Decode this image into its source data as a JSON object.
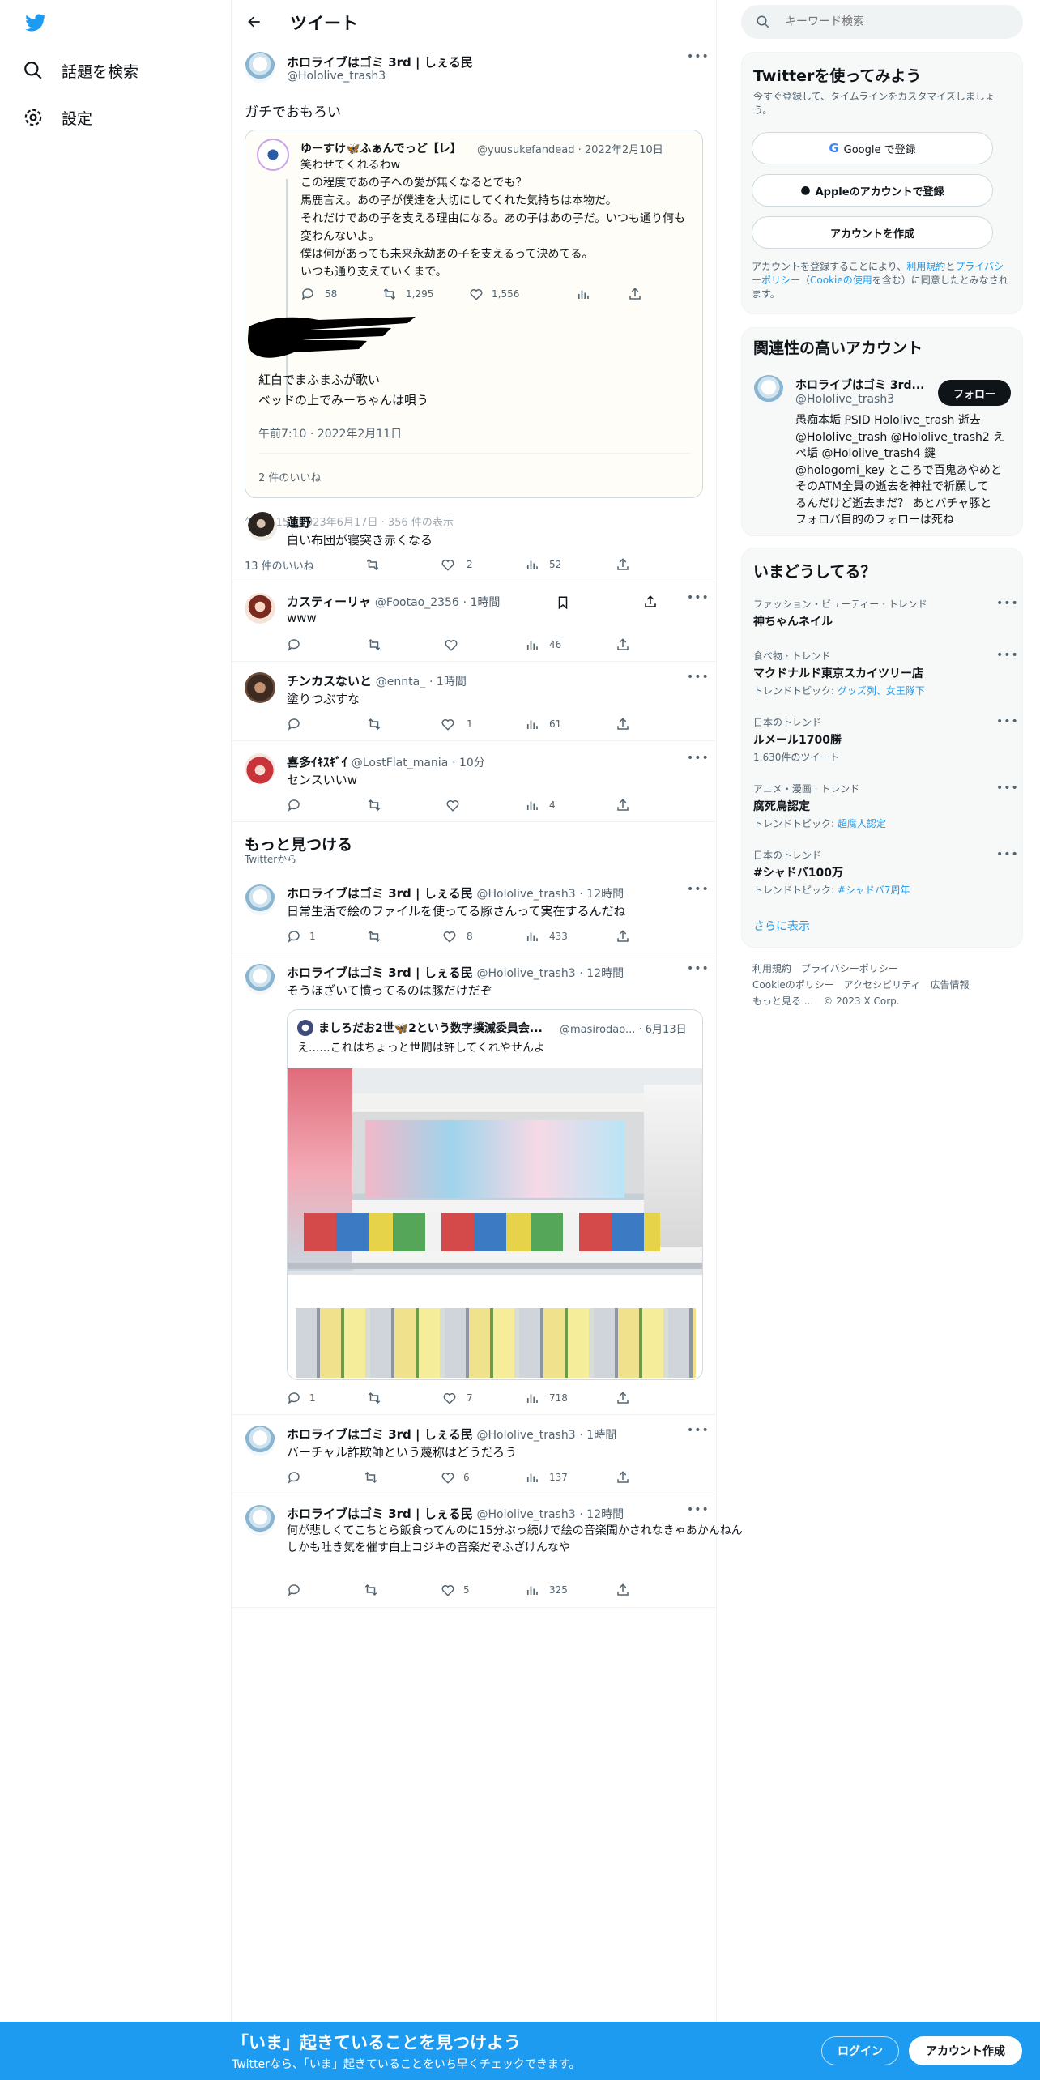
{
  "nav": {
    "search": "話題を検索",
    "settings": "設定"
  },
  "header": {
    "title": "ツイート"
  },
  "main_tweet": {
    "name": "ホロライブはゴミ 3rd | しぇる民",
    "handle": "@Hololive_trash3",
    "text": "ガチでおもろい",
    "quote": {
      "name": "ゆーすけ🦋ふぁんでっど【レ】",
      "handle": "@yuusukefandead",
      "date": "· 2022年2月10日",
      "lines": [
        "笑わせてくれるわw",
        "この程度であの子への愛が無くなるとでも？",
        "馬鹿言え。あの子が僕達を大切にしてくれた気持ちは本物だ。",
        "それだけであの子を支える理由になる。あの子はあの子だ。いつも通り何も",
        "変わんないよ。",
        "僕は何があっても未来永劫あの子を支えるって決めてる。",
        "いつも通り支えていくまで。"
      ],
      "replies": "58",
      "retweets": "1,295",
      "likes": "1,556",
      "reply_lines": [
        "紅白でまふまふが歌い",
        "ベッドの上でみーちゃんは唄う"
      ],
      "reply_time": "午前7:10 · 2022年2月11日",
      "reply_likes": "2 件のいいね"
    },
    "overlap_meta": "午前7:15 · 2023年6月17日 · 356 件の表示",
    "likes_count_label": "13 件のいいね"
  },
  "replies": [
    {
      "name": "蓮野",
      "handle": "",
      "time": "",
      "text": "白い布団が寝突き赤くなる",
      "reply": "",
      "retweet": "",
      "like": "2",
      "views": "52"
    },
    {
      "name": "カスティーリャ",
      "handle": "@Footao_2356",
      "time": "· 1時間",
      "text": "www",
      "reply": "",
      "retweet": "",
      "like": "",
      "views": "46"
    },
    {
      "name": "チンカスないと",
      "handle": "@ennta_",
      "time": "· 1時間",
      "text": "塗りつぶすな",
      "reply": "",
      "retweet": "",
      "like": "1",
      "views": "61"
    },
    {
      "name": "喜多ｲｷｽｷﾞｲ",
      "handle": "@LostFlat_mania",
      "time": "· 10分",
      "text": "センスいいw",
      "reply": "",
      "retweet": "",
      "like": "",
      "views": "4"
    }
  ],
  "more": {
    "title": "もっと見つける",
    "subtitle": "Twitterから"
  },
  "more_tweets": [
    {
      "name": "ホロライブはゴミ 3rd | しぇる民",
      "handle": "@Hololive_trash3",
      "time": "· 12時間",
      "lines": [
        "日常生活で絵のファイルを使ってる豚さんって実在するんだね"
      ],
      "reply": "1",
      "like": "8",
      "views": "433"
    },
    {
      "name": "ホロライブはゴミ 3rd | しぇる民",
      "handle": "@Hololive_trash3",
      "time": "· 12時間",
      "lines": [
        "そうほざいて憤ってるのは豚だけだぞ"
      ],
      "reply": "1",
      "like": "7",
      "views": "718",
      "quote": {
        "name": "ましろだお2世🦋2という数字撲滅委員会...",
        "handle": "@masirodao...",
        "date": "· 6月13日",
        "text": "え......これはちょっと世間は許してくれやせんよ"
      }
    },
    {
      "name": "ホロライブはゴミ 3rd | しぇる民",
      "handle": "@Hololive_trash3",
      "time": "· 1時間",
      "lines": [
        "バーチャル詐欺師という蔑称はどうだろう"
      ],
      "reply": "",
      "like": "6",
      "views": "137"
    },
    {
      "name": "ホロライブはゴミ 3rd | しぇる民",
      "handle": "@Hololive_trash3",
      "time": "· 12時間",
      "lines": [
        "何が悲しくてこちとら飯食ってんのに15分ぶっ続けで絵の音楽聞かされなきゃあかんねん",
        "しかも吐き気を催す白上コジキの音楽だぞふざけんなや"
      ],
      "reply": "",
      "like": "5",
      "views": "325"
    }
  ],
  "search": {
    "placeholder": "キーワード検索"
  },
  "signup": {
    "title": "Twitterを使ってみよう",
    "subtitle": "今すぐ登録して、タイムラインをカスタマイズしましょう。",
    "google": "Google で登録",
    "apple": "Appleのアカウントで登録",
    "create": "アカウントを作成",
    "terms_pre": "アカウントを登録することにより、",
    "terms": "利用規約",
    "and": "と",
    "privacy": "プライバシーポリシー",
    "cookie_pre": "（",
    "cookie": "Cookieの使用",
    "cookie_post": "を含む）に同意したとみなされます。"
  },
  "related": {
    "title": "関連性の高いアカウント",
    "name": "ホロライブはゴミ 3rd...",
    "handle": "@Hololive_trash3",
    "follow": "フォロー",
    "bio_lines": [
      "愚痴本垢 PSID Hololive_trash 逝去",
      "@Hololive_trash @Hololive_trash2 え",
      "ぺ垢 @Hololive_trash4 鍵",
      "@hologomi_key ところで百鬼あやめと",
      "そのATM全員の逝去を神社で祈願して",
      "るんだけど逝去まだ？ あとバチャ豚と",
      "フォロバ目的のフォローは死ね"
    ]
  },
  "trends": {
    "title": "いまどうしてる？",
    "items": [
      {
        "category": "ファッション・ビューティー · トレンド",
        "name": "神ちゃんネイル",
        "meta_label": "",
        "meta_link": ""
      },
      {
        "category": "食べ物 · トレンド",
        "name": "マクドナルド東京スカイツリー店",
        "meta_label": "トレンドトピック: ",
        "meta_link": "グッズ列、女王隊下"
      },
      {
        "category": "日本のトレンド",
        "name": "ルメール1700勝",
        "meta_label": "1,630件のツイート",
        "meta_link": ""
      },
      {
        "category": "アニメ・漫画 · トレンド",
        "name": "腐死鳥認定",
        "meta_label": "トレンドトピック: ",
        "meta_link": "超腐人認定"
      },
      {
        "category": "日本のトレンド",
        "name": "#シャドバ100万",
        "meta_label": "トレンドトピック: ",
        "meta_link": "#シャドバ7周年"
      }
    ],
    "show_more": "さらに表示"
  },
  "footer": {
    "l1": [
      "利用規約",
      "プライバシーポリシー"
    ],
    "l2": [
      "Cookieのポリシー",
      "アクセシビリティ",
      "広告情報"
    ],
    "l3": [
      "もっと見る ...",
      "© 2023 X Corp."
    ]
  },
  "banner": {
    "title": "「いま」起きていることを見つけよう",
    "subtitle": "Twitterなら、「いま」起きていることをいち早くチェックできます。",
    "login": "ログイン",
    "signup": "アカウント作成"
  },
  "colors": {
    "accent": "#1d9bf0",
    "text": "#0f1419",
    "muted": "#536471"
  }
}
